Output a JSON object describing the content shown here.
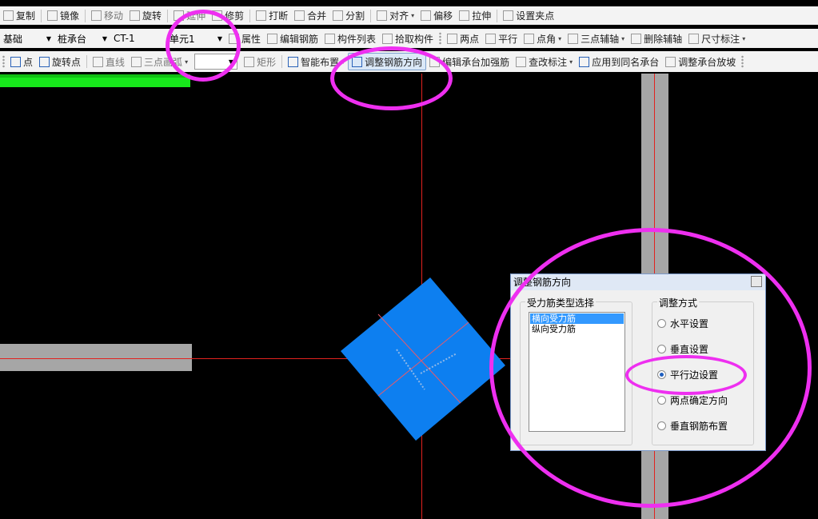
{
  "toolbar1": {
    "copy": "复制",
    "mirror": "镜像",
    "move": "移动",
    "rotate": "旋转",
    "extend": "延伸",
    "trim": "修剪",
    "break": "打断",
    "merge": "合并",
    "split": "分割",
    "align": "对齐",
    "offset": "偏移",
    "stretch": "拉伸",
    "set_grip": "设置夹点"
  },
  "toolbar2": {
    "category": "基础",
    "component_type": "桩承台",
    "component_name": "CT-1",
    "unit": "单元1",
    "properties": "属性",
    "edit_rebar": "编辑钢筋",
    "component_list": "构件列表",
    "pick_component": "拾取构件",
    "two_points": "两点",
    "parallel": "平行",
    "point_angle": "点角",
    "three_point_aux": "三点辅轴",
    "delete_aux": "删除辅轴",
    "dimension": "尺寸标注"
  },
  "toolbar3": {
    "point": "点",
    "rotate_point": "旋转点",
    "line": "直线",
    "three_point_arc": "三点画弧",
    "rectangle": "矩形",
    "smart_layout": "智能布置",
    "adjust_rebar_direction": "调整钢筋方向",
    "edit_cap_rebar": "编辑承台加强筋",
    "check_label": "查改标注",
    "apply_same_cap": "应用到同名承台",
    "adjust_cap_slope": "调整承台放坡"
  },
  "dialog": {
    "title": "调整钢筋方向",
    "rebar_type_group": "受力筋类型选择",
    "rebar_types": [
      "横向受力筋",
      "纵向受力筋"
    ],
    "adjust_group": "调整方式",
    "options": [
      {
        "label": "水平设置",
        "checked": false
      },
      {
        "label": "垂直设置",
        "checked": false
      },
      {
        "label": "平行边设置",
        "checked": true
      },
      {
        "label": "两点确定方向",
        "checked": false
      },
      {
        "label": "垂直钢筋布置",
        "checked": false
      }
    ]
  },
  "colors": {
    "annotation": "#ee2ff0",
    "pile_cap": "#0d7ff0",
    "wall": "#a6a6a6",
    "axis": "#e2221f",
    "highlight_bar": "#17e81b",
    "canvas": "#000000"
  }
}
